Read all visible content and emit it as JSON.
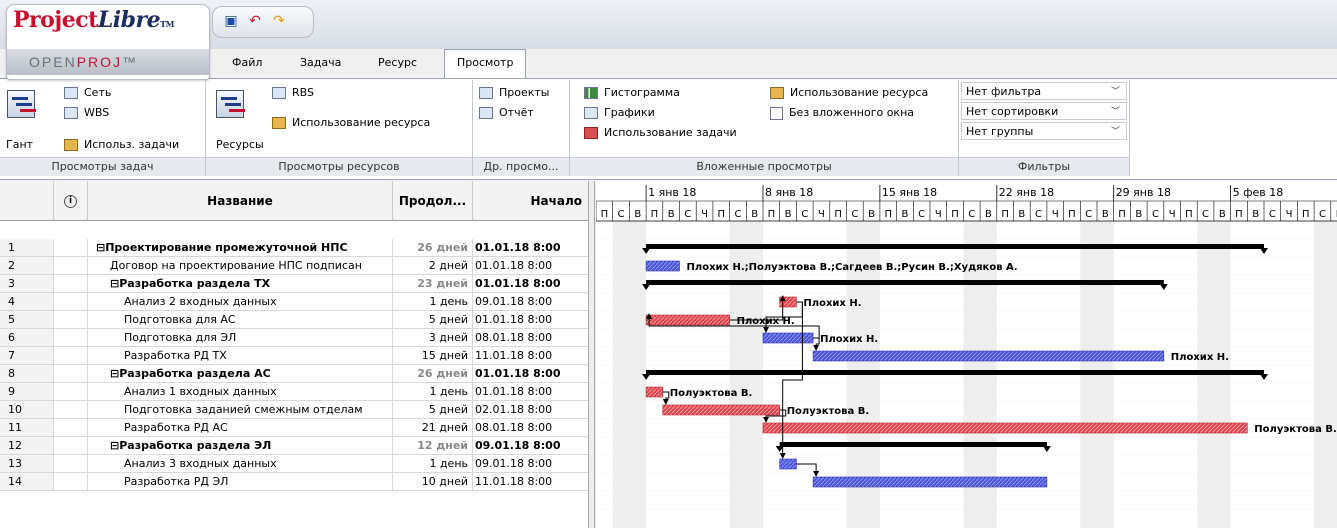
{
  "app": {
    "logo_name_a": "Project",
    "logo_name_b": "Libre",
    "logo_tm": "TM",
    "logo_sub_a": "OPEN",
    "logo_sub_b": "PROJ",
    "logo_sub_tm": "™"
  },
  "quick_access": [
    {
      "icon": "save-icon",
      "glyph": "▣",
      "color": "#1c4ea8"
    },
    {
      "icon": "undo-icon",
      "glyph": "↶",
      "color": "#c8102e"
    },
    {
      "icon": "redo-icon",
      "glyph": "↷",
      "color": "#e59a1c"
    }
  ],
  "menu_tabs": [
    {
      "label": "Файл"
    },
    {
      "label": "Задача"
    },
    {
      "label": "Ресурс"
    },
    {
      "label": "Просмотр",
      "active": true
    }
  ],
  "ribbon": {
    "task_views": {
      "label": "Просмотры задач",
      "gantt": "Гант",
      "network": "Сеть",
      "wbs": "WBS",
      "task_usage": "Использ. задачи"
    },
    "resource_views": {
      "label": "Просмотры ресурсов",
      "resources": "Ресурсы",
      "rbs": "RBS",
      "resource_usage": "Использование ресурса"
    },
    "other_views": {
      "label": "Др. просмо...",
      "projects": "Проекты",
      "report": "Отчёт"
    },
    "sub_views": {
      "label": "Вложенные просмотры",
      "histogram": "Гистограмма",
      "charts": "Графики",
      "task_usage": "Использование задачи",
      "resource_usage": "Использование ресурса",
      "no_subwindow": "Без вложенного окна"
    },
    "filters": {
      "label": "Фильтры",
      "filter": "Нет фильтра",
      "sort": "Нет сортировки",
      "group": "Нет группы"
    }
  },
  "table": {
    "headers": {
      "name": "Название",
      "duration": "Продол...",
      "start": "Начало"
    },
    "rows": [
      {
        "id": "1",
        "indent": 0,
        "summary": true,
        "toggle": "⊟",
        "name": "Проектирование промежуточной НПС",
        "duration": "26 дней",
        "start": "01.01.18 8:00",
        "indicator": true
      },
      {
        "id": "2",
        "indent": 1,
        "summary": false,
        "name": "Договор на проектирование НПС подписан",
        "duration": "2 дней",
        "start": "01.01.18 8:00"
      },
      {
        "id": "3",
        "indent": 1,
        "summary": true,
        "toggle": "⊟",
        "name": "Разработка раздела ТХ",
        "duration": "23 дней",
        "start": "01.01.18 8:00"
      },
      {
        "id": "4",
        "indent": 2,
        "summary": false,
        "name": "Анализ 2 входных данных",
        "duration": "1 день",
        "start": "09.01.18 8:00"
      },
      {
        "id": "5",
        "indent": 2,
        "summary": false,
        "name": "Подготовка для АС",
        "duration": "5 дней",
        "start": "01.01.18 8:00"
      },
      {
        "id": "6",
        "indent": 2,
        "summary": false,
        "name": "Подготовка  для ЭЛ",
        "duration": "3 дней",
        "start": "08.01.18 8:00"
      },
      {
        "id": "7",
        "indent": 2,
        "summary": false,
        "name": "Разработка РД ТХ",
        "duration": "15 дней",
        "start": "11.01.18 8:00"
      },
      {
        "id": "8",
        "indent": 1,
        "summary": true,
        "toggle": "⊟",
        "name": "Разработка раздела АС",
        "duration": "26 дней",
        "start": "01.01.18 8:00"
      },
      {
        "id": "9",
        "indent": 2,
        "summary": false,
        "name": "Анализ 1 входных данных",
        "duration": "1 день",
        "start": "01.01.18 8:00"
      },
      {
        "id": "10",
        "indent": 2,
        "summary": false,
        "name": "Подготовка заданией смежным отделам",
        "duration": "5 дней",
        "start": "02.01.18 8:00"
      },
      {
        "id": "11",
        "indent": 2,
        "summary": false,
        "name": "Разработка РД АС",
        "duration": "21 дней",
        "start": "08.01.18 8:00"
      },
      {
        "id": "12",
        "indent": 1,
        "summary": true,
        "toggle": "⊟",
        "name": "Разработка раздела ЭЛ",
        "duration": "12 дней",
        "start": "09.01.18 8:00"
      },
      {
        "id": "13",
        "indent": 2,
        "summary": false,
        "name": "Анализ 3 входных данных",
        "duration": "1 день",
        "start": "09.01.18 8:00"
      },
      {
        "id": "14",
        "indent": 2,
        "summary": false,
        "name": "Разработка РД ЭЛ",
        "duration": "10 дней",
        "start": "11.01.18 8:00"
      }
    ]
  },
  "gantt": {
    "start_date": "2017-12-29",
    "weeks": [
      "1 янв 18",
      "8 янв 18",
      "15 янв 18",
      "22 янв 18",
      "29 янв 18",
      "5 фев 18"
    ],
    "day_letters": [
      "П",
      "С",
      "В",
      "П",
      "В",
      "С",
      "Ч"
    ],
    "colors": {
      "summary": "#000000",
      "blue": "#4b55d6",
      "red": "#e2444d",
      "weekend": "#eeeeee"
    },
    "bars": [
      {
        "row": 0,
        "type": "summary",
        "start": "2018-01-01",
        "end": "2018-02-06"
      },
      {
        "row": 1,
        "type": "blue",
        "start": "2018-01-01",
        "end": "2018-01-02",
        "label": "Плохих Н.;Полуэктова В.;Сагдеев В.;Русин В.;Худяков А."
      },
      {
        "row": 2,
        "type": "summary",
        "start": "2018-01-01",
        "end": "2018-01-31"
      },
      {
        "row": 3,
        "type": "red",
        "start": "2018-01-09",
        "end": "2018-01-09",
        "label": "Плохих Н."
      },
      {
        "row": 4,
        "type": "red",
        "start": "2018-01-01",
        "end": "2018-01-05",
        "label": "Плохих Н."
      },
      {
        "row": 5,
        "type": "blue",
        "start": "2018-01-08",
        "end": "2018-01-10",
        "label": "Плохих Н."
      },
      {
        "row": 6,
        "type": "blue",
        "start": "2018-01-11",
        "end": "2018-01-31",
        "label": "Плохих Н."
      },
      {
        "row": 7,
        "type": "summary",
        "start": "2018-01-01",
        "end": "2018-02-06"
      },
      {
        "row": 8,
        "type": "red",
        "start": "2018-01-01",
        "end": "2018-01-01",
        "label": "Полуэктова В."
      },
      {
        "row": 9,
        "type": "red",
        "start": "2018-01-02",
        "end": "2018-01-08",
        "label": "Полуэктова В."
      },
      {
        "row": 10,
        "type": "red",
        "start": "2018-01-08",
        "end": "2018-02-05",
        "label": "Полуэктова В."
      },
      {
        "row": 11,
        "type": "summary",
        "start": "2018-01-09",
        "end": "2018-01-24"
      },
      {
        "row": 12,
        "type": "blue",
        "start": "2018-01-09",
        "end": "2018-01-09"
      },
      {
        "row": 13,
        "type": "blue",
        "start": "2018-01-11",
        "end": "2018-01-24"
      }
    ],
    "links": [
      {
        "from": 4,
        "to": 3
      },
      {
        "from": 3,
        "to": 5
      },
      {
        "from": 5,
        "to": 6
      },
      {
        "from": 8,
        "to": 9
      },
      {
        "from": 9,
        "to": 10
      },
      {
        "from": 3,
        "to": 12
      },
      {
        "from": 12,
        "to": 13
      },
      {
        "from": 5,
        "to": 4
      }
    ]
  }
}
